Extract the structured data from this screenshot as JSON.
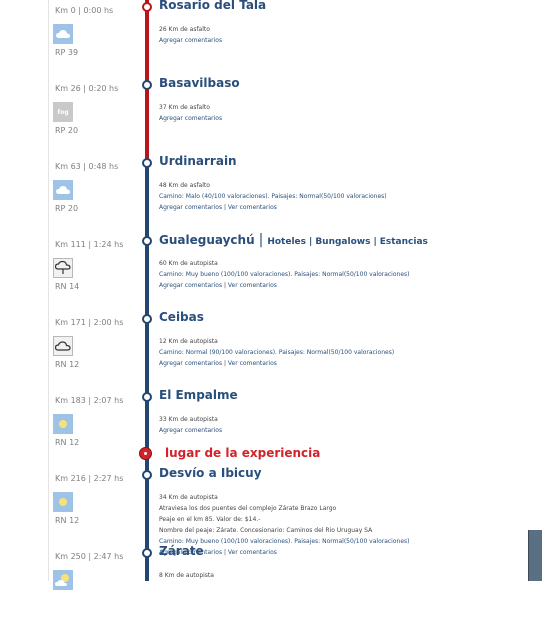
{
  "route": {
    "stops": [
      {
        "meta": "Km 0 | 0:00 hs",
        "weather": "cloudy",
        "road": "RP 39",
        "name": "Rosario del Tala",
        "links": [],
        "details": [
          {
            "parts": [
              {
                "t": "26 Km de asfalto",
                "link": false
              }
            ]
          },
          {
            "parts": [
              {
                "t": "Agregar comentarios",
                "link": true
              }
            ]
          }
        ]
      },
      {
        "meta": "Km 26 | 0:20 hs",
        "weather": "fog",
        "weather_label": "fog",
        "road": "RP 20",
        "name": "Basavilbaso",
        "links": [],
        "details": [
          {
            "parts": [
              {
                "t": "37 Km de asfalto",
                "link": false
              }
            ]
          },
          {
            "parts": [
              {
                "t": "Agregar comentarios",
                "link": true
              }
            ]
          }
        ]
      },
      {
        "meta": "Km 63 | 0:48 hs",
        "weather": "cloudy",
        "road": "RP 20",
        "name": "Urdinarrain",
        "links": [],
        "details": [
          {
            "parts": [
              {
                "t": "48 Km de asfalto",
                "link": false
              }
            ]
          },
          {
            "parts": [
              {
                "t": "Camino: Malo (40/100 valoraciones). Paisajes: Normal(50/100 valoraciones)",
                "link": true
              }
            ]
          },
          {
            "parts": [
              {
                "t": "Agregar comentarios",
                "link": true
              },
              {
                "t": " | ",
                "link": false
              },
              {
                "t": "Ver comentarios",
                "link": true
              }
            ]
          }
        ]
      },
      {
        "meta": "Km 111 | 1:24 hs",
        "weather": "rain",
        "road": "RN 14",
        "name": "Gualeguaychú",
        "links": [
          "Hoteles",
          "Bungalows",
          "Estancias"
        ],
        "details": [
          {
            "parts": [
              {
                "t": "60 Km de autopista",
                "link": false
              }
            ]
          },
          {
            "parts": [
              {
                "t": "Camino: Muy bueno (100/100 valoraciones). Paisajes: Normal(50/100 valoraciones)",
                "link": true
              }
            ]
          },
          {
            "parts": [
              {
                "t": "Agregar comentarios",
                "link": true
              },
              {
                "t": " | ",
                "link": false
              },
              {
                "t": "Ver comentarios",
                "link": true
              }
            ]
          }
        ]
      },
      {
        "meta": "Km 171 | 2:00 hs",
        "weather": "cloud-outline",
        "road": "RN 12",
        "name": "Ceibas",
        "links": [],
        "details": [
          {
            "parts": [
              {
                "t": "12 Km de autopista",
                "link": false
              }
            ]
          },
          {
            "parts": [
              {
                "t": "Camino: Normal (90/100 valoraciones). Paisajes: Normal(50/100 valoraciones)",
                "link": true
              }
            ]
          },
          {
            "parts": [
              {
                "t": "Agregar comentarios",
                "link": true
              },
              {
                "t": " | ",
                "link": false
              },
              {
                "t": "Ver comentarios",
                "link": true
              }
            ]
          }
        ]
      },
      {
        "meta": "Km 183 | 2:07 hs",
        "weather": "sunny",
        "road": "RN 12",
        "name": "El Empalme",
        "links": [],
        "details": [
          {
            "parts": [
              {
                "t": "33 Km de autopista",
                "link": false
              }
            ]
          },
          {
            "parts": [
              {
                "t": "Agregar comentarios",
                "link": true
              }
            ]
          }
        ]
      },
      {
        "meta": "Km 216 | 2:27 hs",
        "weather": "sunny",
        "road": "RN 12",
        "name": "Desvío a Ibicuy",
        "links": [],
        "details": [
          {
            "parts": [
              {
                "t": "34 Km de autopista",
                "link": false
              }
            ]
          },
          {
            "parts": [
              {
                "t": "Atraviesa los dos puentes del complejo Zárate Brazo Largo",
                "link": false
              }
            ]
          },
          {
            "parts": [
              {
                "t": "Peaje en el km 85. Valor de: $14.-",
                "link": false
              }
            ]
          },
          {
            "parts": [
              {
                "t": "Nombre del peaje: Zárate. Concesionario: Caminos del Rio Uruguay SA",
                "link": false
              }
            ]
          },
          {
            "parts": [
              {
                "t": "Camino: Muy bueno (100/100 valoraciones). Paisajes: Normal(50/100 valoraciones)",
                "link": true
              }
            ]
          },
          {
            "parts": [
              {
                "t": "Agregar comentarios",
                "link": true
              },
              {
                "t": " | ",
                "link": false
              },
              {
                "t": "Ver comentarios",
                "link": true
              }
            ]
          }
        ]
      },
      {
        "meta": "Km 250 | 2:47 hs",
        "weather": "partly-cloudy",
        "road": "",
        "name": "Zárate",
        "links": [],
        "details": [
          {
            "parts": [
              {
                "t": "8 Km de autopista",
                "link": false
              }
            ]
          }
        ]
      }
    ]
  },
  "experience": {
    "label": "lugar de la experiencia"
  },
  "colors": {
    "red_line": "#b8151b",
    "blue_line": "#22466f",
    "link": "#2a4f7b",
    "experience": "#d2232a"
  }
}
